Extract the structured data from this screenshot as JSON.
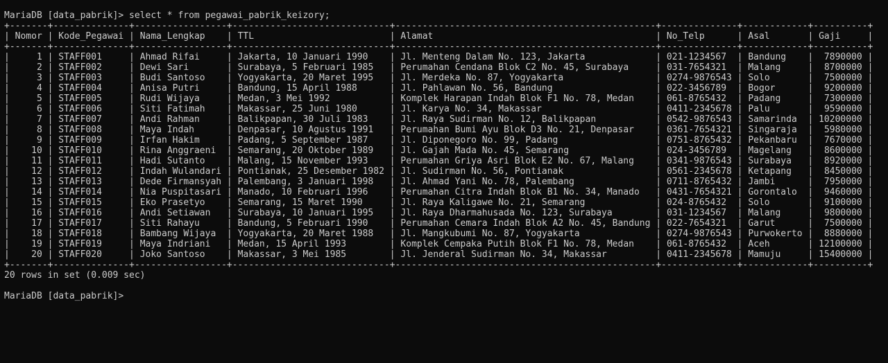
{
  "prompt": "MariaDB [data_pabrik]>",
  "query": "select * from pegawai_pabrik_keizory;",
  "table": {
    "columns": [
      "Nomor",
      "Kode_Pegawai",
      "Nama_Lengkap",
      "TTL",
      "Alamat",
      "No_Telp",
      "Asal",
      "Gaji"
    ],
    "rows": [
      [
        "1",
        "STAFF001",
        "Ahmad Rifai",
        "Jakarta, 10 Januari 1990",
        "Jl. Menteng Dalam No. 123, Jakarta",
        "021-1234567",
        "Bandung",
        "7890000"
      ],
      [
        "2",
        "STAFF002",
        "Dewi Sari",
        "Surabaya, 5 Februari 1985",
        "Perumahan Cendana Blok C2 No. 45, Surabaya",
        "031-7654321",
        "Malang",
        "8700000"
      ],
      [
        "3",
        "STAFF003",
        "Budi Santoso",
        "Yogyakarta, 20 Maret 1995",
        "Jl. Merdeka No. 87, Yogyakarta",
        "0274-9876543",
        "Solo",
        "7500000"
      ],
      [
        "4",
        "STAFF004",
        "Anisa Putri",
        "Bandung, 15 April 1988",
        "Jl. Pahlawan No. 56, Bandung",
        "022-3456789",
        "Bogor",
        "9200000"
      ],
      [
        "5",
        "STAFF005",
        "Rudi Wijaya",
        "Medan, 3 Mei 1992",
        "Komplek Harapan Indah Blok F1 No. 78, Medan",
        "061-8765432",
        "Padang",
        "7300000"
      ],
      [
        "6",
        "STAFF006",
        "Siti Fatimah",
        "Makassar, 25 Juni 1980",
        "Jl. Karya No. 34, Makassar",
        "0411-2345678",
        "Palu",
        "9590000"
      ],
      [
        "7",
        "STAFF007",
        "Andi Rahman",
        "Balikpapan, 30 Juli 1983",
        "Jl. Raya Sudirman No. 12, Balikpapan",
        "0542-9876543",
        "Samarinda",
        "10200000"
      ],
      [
        "8",
        "STAFF008",
        "Maya Indah",
        "Denpasar, 10 Agustus 1991",
        "Perumahan Bumi Ayu Blok D3 No. 21, Denpasar",
        "0361-7654321",
        "Singaraja",
        "5980000"
      ],
      [
        "9",
        "STAFF009",
        "Irfan Hakim",
        "Padang, 5 September 1987",
        "Jl. Diponegoro No. 99, Padang",
        "0751-8765432",
        "Pekanbaru",
        "7670000"
      ],
      [
        "10",
        "STAFF010",
        "Rina Anggraeni",
        "Semarang, 20 Oktober 1989",
        "Jl. Gajah Mada No. 45, Semarang",
        "024-3456789",
        "Magelang",
        "8600000"
      ],
      [
        "11",
        "STAFF011",
        "Hadi Sutanto",
        "Malang, 15 November 1993",
        "Perumahan Griya Asri Blok E2 No. 67, Malang",
        "0341-9876543",
        "Surabaya",
        "8920000"
      ],
      [
        "12",
        "STAFF012",
        "Indah Wulandari",
        "Pontianak, 25 Desember 1982",
        "Jl. Sudirman No. 56, Pontianak",
        "0561-2345678",
        "Ketapang",
        "8450000"
      ],
      [
        "13",
        "STAFF013",
        "Dede Firmansyah",
        "Palembang, 3 Januari 1998",
        "Jl. Ahmad Yani No. 78, Palembang",
        "0711-8765432",
        "Jambi",
        "7950000"
      ],
      [
        "14",
        "STAFF014",
        "Nia Puspitasari",
        "Manado, 10 Februari 1996",
        "Perumahan Citra Indah Blok B1 No. 34, Manado",
        "0431-7654321",
        "Gorontalo",
        "9460000"
      ],
      [
        "15",
        "STAFF015",
        "Eko Prasetyo",
        "Semarang, 15 Maret 1990",
        "Jl. Raya Kaligawe No. 21, Semarang",
        "024-8765432",
        "Solo",
        "9100000"
      ],
      [
        "16",
        "STAFF016",
        "Andi Setiawan",
        "Surabaya, 10 Januari 1995",
        "Jl. Raya Dharmahusada No. 123, Surabaya",
        "031-1234567",
        "Malang",
        "9800000"
      ],
      [
        "17",
        "STAFF017",
        "Siti Rahayu",
        "Bandung, 5 Februari 1990",
        "Perumahan Cemara Indah Blok A2 No. 45, Bandung",
        "022-7654321",
        "Garut",
        "7500000"
      ],
      [
        "18",
        "STAFF018",
        "Bambang Wijaya",
        "Yogyakarta, 20 Maret 1988",
        "Jl. Mangkubumi No. 87, Yogyakarta",
        "0274-9876543",
        "Purwokerto",
        "8880000"
      ],
      [
        "19",
        "STAFF019",
        "Maya Indriani",
        "Medan, 15 April 1993",
        "Komplek Cempaka Putih Blok F1 No. 78, Medan",
        "061-8765432",
        "Aceh",
        "12100000"
      ],
      [
        "20",
        "STAFF020",
        "Joko Santoso",
        "Makassar, 3 Mei 1985",
        "Jl. Jenderal Sudirman No. 34, Makassar",
        "0411-2345678",
        "Mamuju",
        "15400000"
      ]
    ]
  },
  "result_summary": "20 rows in set (0.009 sec)",
  "colors": {
    "background": "#0c0c0c",
    "text": "#cccccc"
  }
}
